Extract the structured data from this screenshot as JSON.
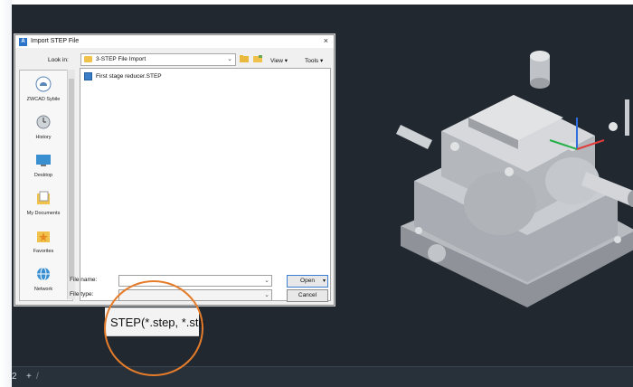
{
  "dialog": {
    "title": "Import STEP File",
    "app_icon_label": "A",
    "close_glyph": "×",
    "look_in_label": "Look in:",
    "look_in_value": "3-STEP File Import",
    "toolbar": {
      "view_label": "View ▾",
      "tools_label": "Tools ▾"
    },
    "places": [
      {
        "label": "ZWCAD Sybile",
        "icon": "cloud-icon"
      },
      {
        "label": "History",
        "icon": "history-icon"
      },
      {
        "label": "Desktop",
        "icon": "desktop-icon"
      },
      {
        "label": "My Documents",
        "icon": "documents-icon"
      },
      {
        "label": "Favorites",
        "icon": "favorites-icon"
      },
      {
        "label": "Network",
        "icon": "network-icon"
      }
    ],
    "files": [
      {
        "name": "First stage reducer.STEP",
        "icon": "step-file-icon"
      }
    ],
    "file_name_label": "File name:",
    "file_name_value": "",
    "file_type_label": "File type:",
    "file_type_value": "",
    "open_button": "Open",
    "cancel_button": "Cancel"
  },
  "magnifier": {
    "text": "STEP(*.step, *.ste"
  },
  "tabs": {
    "left_text": "2",
    "plus": "+",
    "slash": "/"
  },
  "colors": {
    "canvas": "#212830",
    "accent": "#e57c2a",
    "dialog": "#f0f0f0"
  }
}
